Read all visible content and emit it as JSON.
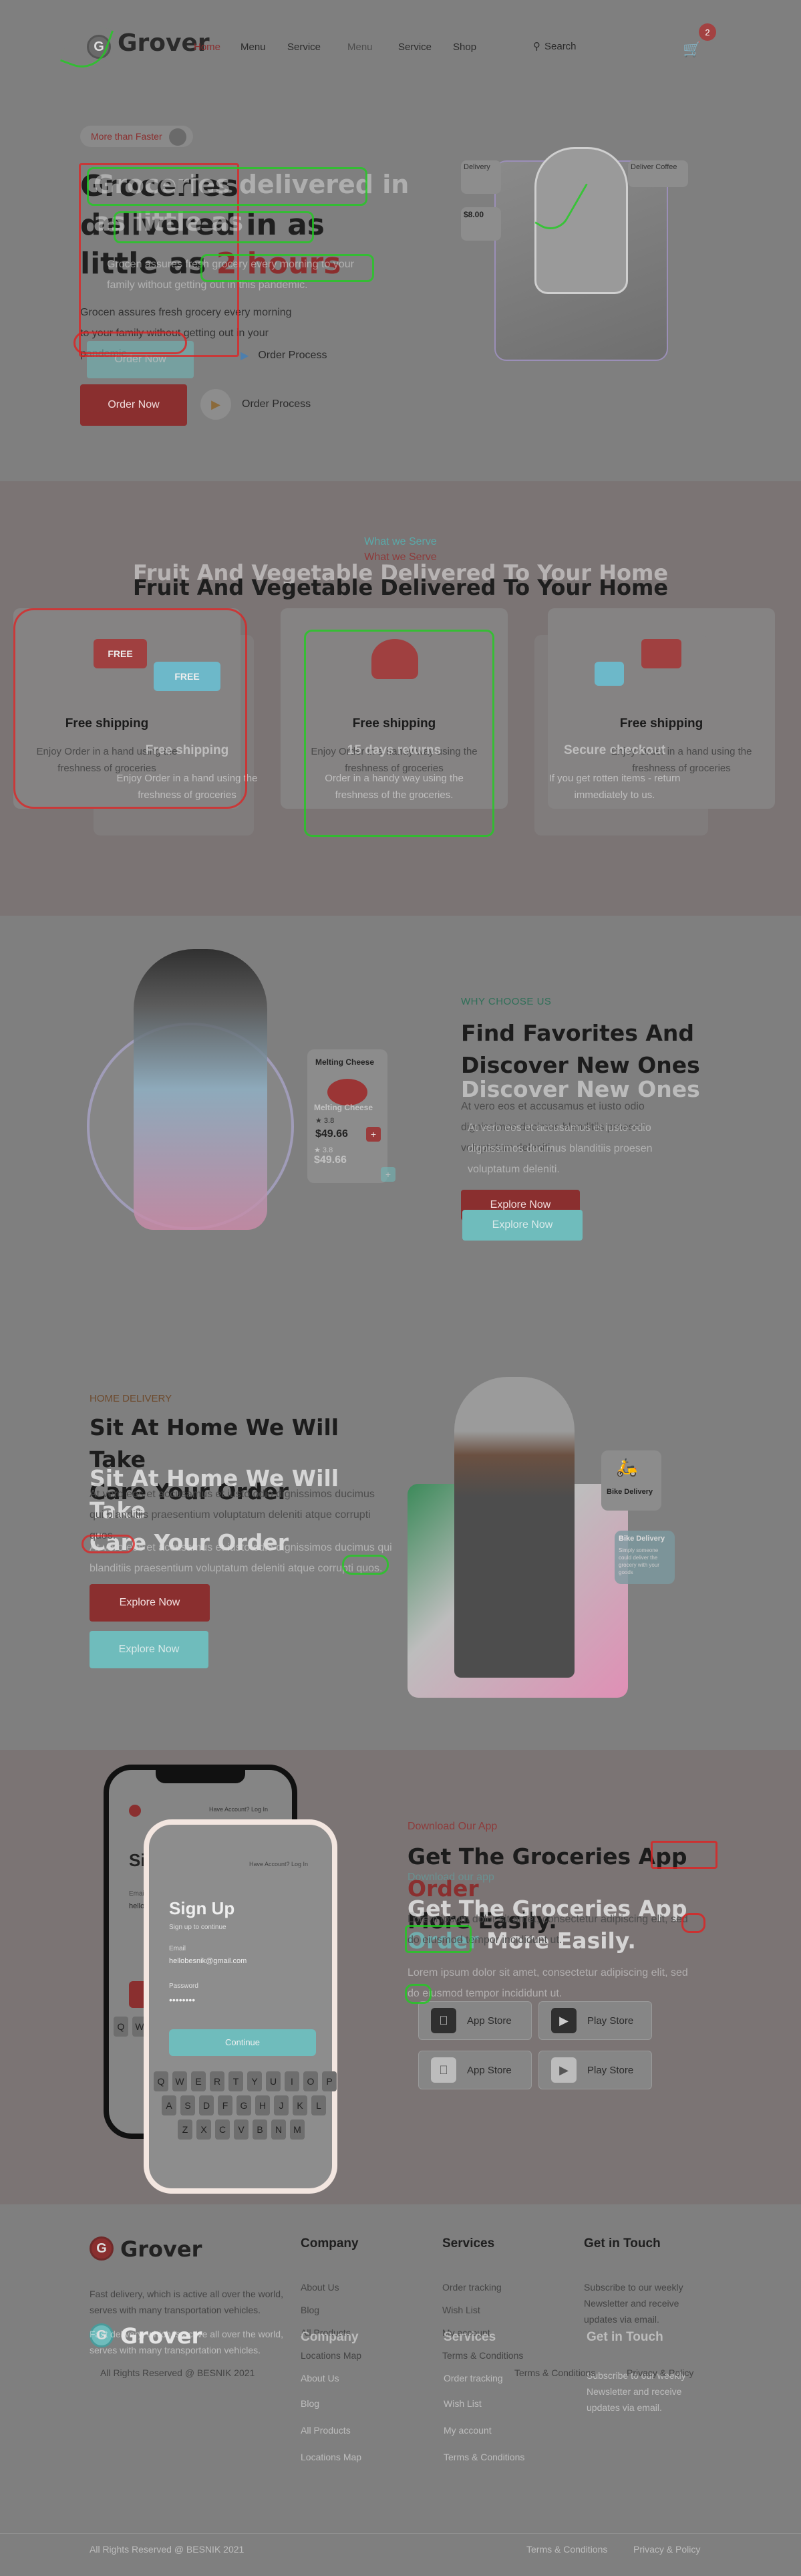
{
  "header": {
    "logo_letter": "G",
    "logo_text": "Grover",
    "nav": [
      "Home",
      "Menu",
      "Service",
      "Shop"
    ],
    "nav_ghost": [
      "Service",
      "Menu",
      "Service",
      "Shop"
    ],
    "search_label": "Search",
    "cart_count": "2"
  },
  "hero": {
    "badge": "More than Faster",
    "title_line1": "Groceries delivered in",
    "title_line2": "as little as",
    "title_accent": "2 hours",
    "title_ghost_line1": "Groceries",
    "title_ghost_line2": "delivered in as",
    "title_ghost_line3": "little as",
    "title_ghost_accent": "2 hours",
    "para": "Grocen assures fresh grocery every morning to your family without getting out in your pandemic.",
    "ghost_para": "Grocen assures fresh grocery every morning to your family without getting out in this pandemic.",
    "order_button": "Order Now",
    "order_button_ghost": "Order Now",
    "process_label": "Order Process",
    "process_label_ghost": "Order Process",
    "card_small_label": "Delivery",
    "card_price": "$8.00",
    "card_sub": "Deliver Coffee"
  },
  "services": {
    "tag": "What we Serve",
    "tag_ghost": "What we Serve",
    "title": "Fruit And Vegetable Delivered To Your Home",
    "title_ghost": "Fruit And Vegetable Delivered To Your Home",
    "cards": [
      {
        "title": "Free shipping",
        "desc": "Enjoy Order in a hand using the freshness of groceries"
      },
      {
        "title": "Free shipping",
        "desc": "Enjoy Order in a handy way using the freshness of groceries"
      },
      {
        "title": "Free shipping",
        "desc": "Enjoy Order in a hand using the freshness of groceries"
      }
    ],
    "ghost_cards": [
      {
        "title": "Free shipping",
        "desc": "Enjoy Order in a hand using the freshness of groceries"
      },
      {
        "title": "15 days returns",
        "desc": "Order in a handy way using the freshness of the groceries."
      },
      {
        "title": "Secure checkout",
        "desc": "If you get rotten items - return immediately to us."
      }
    ],
    "icon_labels": [
      "FREE",
      "FREE"
    ]
  },
  "why": {
    "tag": "WHY CHOOSE US",
    "title_line1": "Find Favorites And",
    "title_line2": "Discover New Ones",
    "ghost_line1": "Discover New Ones",
    "para": "At vero eos et accusamus et iusto odio dignissimos ducimus blanditiis proesen voluptatum deleniti.",
    "ghost_para": "At vero eos et accusamus et iusto odio dignissimos ducimus blanditiis proesen voluptatum deleniti.",
    "button": "Explore Now",
    "button_ghost": "Explore Now",
    "product_name": "Melting Cheese",
    "product_rating": "3.8",
    "product_price": "$49.66",
    "product_name_ghost": "Melting Cheese",
    "product_price_ghost": "$49.66",
    "product_rating_ghost": "3.8"
  },
  "delivery": {
    "tag": "HOME DELIVERY",
    "title_line1": "Sit At Home We Will Take",
    "title_line2": "Care Your Order",
    "ghost_line1": "Sit At Home We Will Take",
    "ghost_line2": "Care Your Order",
    "para": "At vero eos et accusamus et iusto odio dignissimos ducimus qui blanditiis praesentium voluptatum deleniti atque corrupti quos.",
    "ghost_para": "At vero eos et accusamus et iusto odio dignissimos ducimus qui blanditiis praesentium voluptatum deleniti atque corrupti quos.",
    "button": "Explore Now",
    "button_ghost": "Explore Now",
    "bike_label": "Bike Delivery",
    "bike_label_ghost": "Bike Delivery",
    "bike_sub": "Simply someone could deliver the grocery with your goods"
  },
  "app": {
    "tag": "Download Our App",
    "tag_ghost": "Download our app",
    "title_line1": "Get The Groceries App",
    "title_accent": "Order",
    "title_line2": "More Easily.",
    "ghost_line1": "Get The Groceries App",
    "ghost_accent": "Order",
    "ghost_line2": "More Easily.",
    "para": "Lorem ipsum dolor sit amet, consectetur adipiscing elit, sed do eiusmod tempor incididunt ut.",
    "ghost_para": "Lorem ipsum dolor sit amet, consectetur adipiscing elit, sed do eiusmod tempor incididunt ut.",
    "app_store": "App Store",
    "play_store": "Play Store",
    "app_store_ghost": "App Store",
    "play_store_ghost": "Play Store",
    "phone": {
      "top_link": "Have Account? Log In",
      "signup": "Sign Up",
      "sub": "Sign up to continue",
      "email_label": "Email",
      "email": "hellobesnik@gmail.com",
      "password_label": "Password",
      "password": "••••••••",
      "button": "Continue",
      "keys_row1": [
        "Q",
        "W",
        "E",
        "R",
        "T",
        "Y",
        "U",
        "I",
        "O",
        "P"
      ],
      "keys_row2": [
        "A",
        "S",
        "D",
        "F",
        "G",
        "H",
        "J",
        "K",
        "L"
      ],
      "keys_row3": [
        "Z",
        "X",
        "C",
        "V",
        "B",
        "N",
        "M"
      ]
    }
  },
  "footer": {
    "logo_letter": "G",
    "logo_text": "Grover",
    "about": "Fast delivery, which is active all over the world, serves with many transportation vehicles.",
    "columns": [
      {
        "title": "Company",
        "links": [
          "About Us",
          "Blog",
          "All Products",
          "Locations Map"
        ]
      },
      {
        "title": "Services",
        "links": [
          "Order tracking",
          "Wish List",
          "My account",
          "Terms & Conditions"
        ]
      },
      {
        "title": "Get in Touch",
        "links": [
          "Subscribe to our weekly Newsletter and receive updates via email."
        ]
      }
    ],
    "ghost_columns": [
      {
        "title": "Company",
        "links": [
          "About Us",
          "Blog",
          "All Products",
          "Locations Map"
        ]
      },
      {
        "title": "Services",
        "links": [
          "Order tracking",
          "Wish List",
          "My account",
          "Terms & Conditions"
        ]
      },
      {
        "title": "Get in Touch",
        "links": [
          "Subscribe to our weekly Newsletter and receive updates via email."
        ]
      }
    ],
    "copyright": "All Rights Reserved @ BESNIK 2021",
    "copyright_ghost": "All Rights Reserved @ BESNIK 2021",
    "terms": "Terms & Conditions",
    "privacy": "Privacy & Policy",
    "terms_ghost": "Terms & Conditions",
    "privacy_ghost": "Privacy & Policy"
  },
  "colors": {
    "page_bg": "#7f7f7f",
    "accent_red": "#8a2f2f",
    "accent_teal": "#6fbcbc",
    "annotation_red": "#e02020",
    "annotation_green": "#22cc22"
  }
}
